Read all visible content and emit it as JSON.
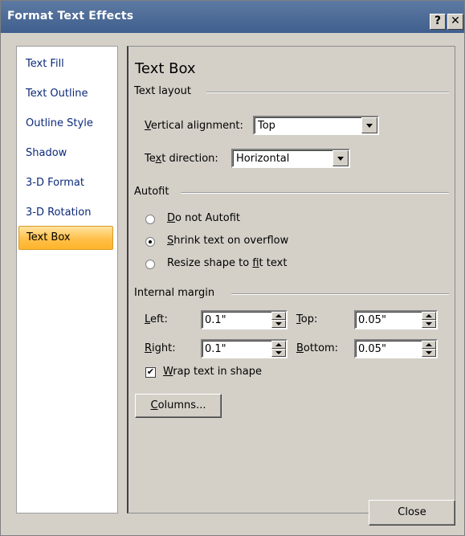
{
  "window": {
    "title": "Format Text Effects",
    "help_label": "?",
    "close_label": "✕"
  },
  "nav": {
    "items": [
      {
        "label": "Text Fill"
      },
      {
        "label": "Text Outline"
      },
      {
        "label": "Outline Style"
      },
      {
        "label": "Shadow"
      },
      {
        "label": "3-D Format"
      },
      {
        "label": "3-D Rotation"
      },
      {
        "label": "Text Box",
        "selected": true
      }
    ],
    "selected_color": "#ffc04a"
  },
  "panel": {
    "heading": "Text Box",
    "text_layout": {
      "group_label": "Text layout",
      "vertical_alignment": {
        "label_pre": "",
        "label_u": "V",
        "label_post": "ertical alignment:",
        "value": "Top"
      },
      "text_direction": {
        "label_pre": "Te",
        "label_u": "x",
        "label_post": "t direction:",
        "value": "Horizontal"
      }
    },
    "autofit": {
      "group_label": "Autofit",
      "options": [
        {
          "pre": "",
          "u": "D",
          "post": "o not Autofit",
          "checked": false
        },
        {
          "pre": "",
          "u": "S",
          "post": "hrink text on overflow",
          "checked": true
        },
        {
          "pre": "Resize shape to ",
          "u": "f",
          "post": "it text",
          "checked": false
        }
      ]
    },
    "internal_margin": {
      "group_label": "Internal margin",
      "left": {
        "label_u": "L",
        "label_post": "eft:",
        "value": "0.1\""
      },
      "top": {
        "label_u": "T",
        "label_post": "op:",
        "value": "0.05\""
      },
      "right": {
        "label_u": "R",
        "label_post": "ight:",
        "value": "0.1\""
      },
      "bottom": {
        "label_u": "B",
        "label_post": "ottom:",
        "value": "0.05\""
      },
      "wrap": {
        "label_u": "W",
        "label_post": "rap text in shape",
        "checked": true,
        "mark": "✔"
      }
    },
    "columns_button": {
      "label_u": "C",
      "label_post": "olumns..."
    }
  },
  "footer": {
    "close_label": "Close"
  }
}
